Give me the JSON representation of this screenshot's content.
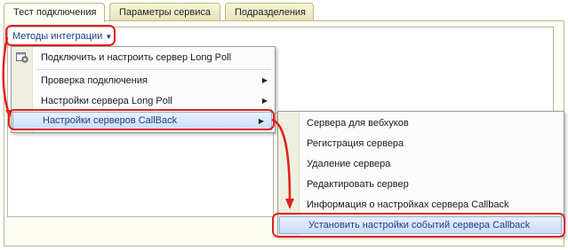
{
  "tabs": [
    {
      "label": "Тест подключения",
      "active": true
    },
    {
      "label": "Параметры сервиса",
      "active": false
    },
    {
      "label": "Подразделения",
      "active": false
    }
  ],
  "methods_button": {
    "label": "Методы интеграции",
    "caret_icon": "chevron-down-icon"
  },
  "main_menu": {
    "items": [
      {
        "label": "Подключить и настроить сервер Long Poll",
        "icon": "gear-window-icon"
      },
      {
        "label": "Проверка подключения",
        "submenu": true
      },
      {
        "label": "Настройки сервера Long Poll",
        "submenu": true
      },
      {
        "label": "Настройки серверов CallBack",
        "submenu": true,
        "highlighted": true
      }
    ]
  },
  "sub_menu": {
    "items": [
      {
        "label": "Сервера для вебхуков"
      },
      {
        "label": "Регистрация сервера"
      },
      {
        "label": "Удаление сервера"
      },
      {
        "label": "Редактировать сервер"
      },
      {
        "label": "Информация о настройках сервера Callback"
      },
      {
        "label": "Установить настройки событий сервера Callback",
        "highlighted": true
      }
    ]
  },
  "colors": {
    "annotation_red": "#e02020",
    "highlight_blue": "#c9dcf6",
    "link_blue": "#1c3d8c"
  }
}
